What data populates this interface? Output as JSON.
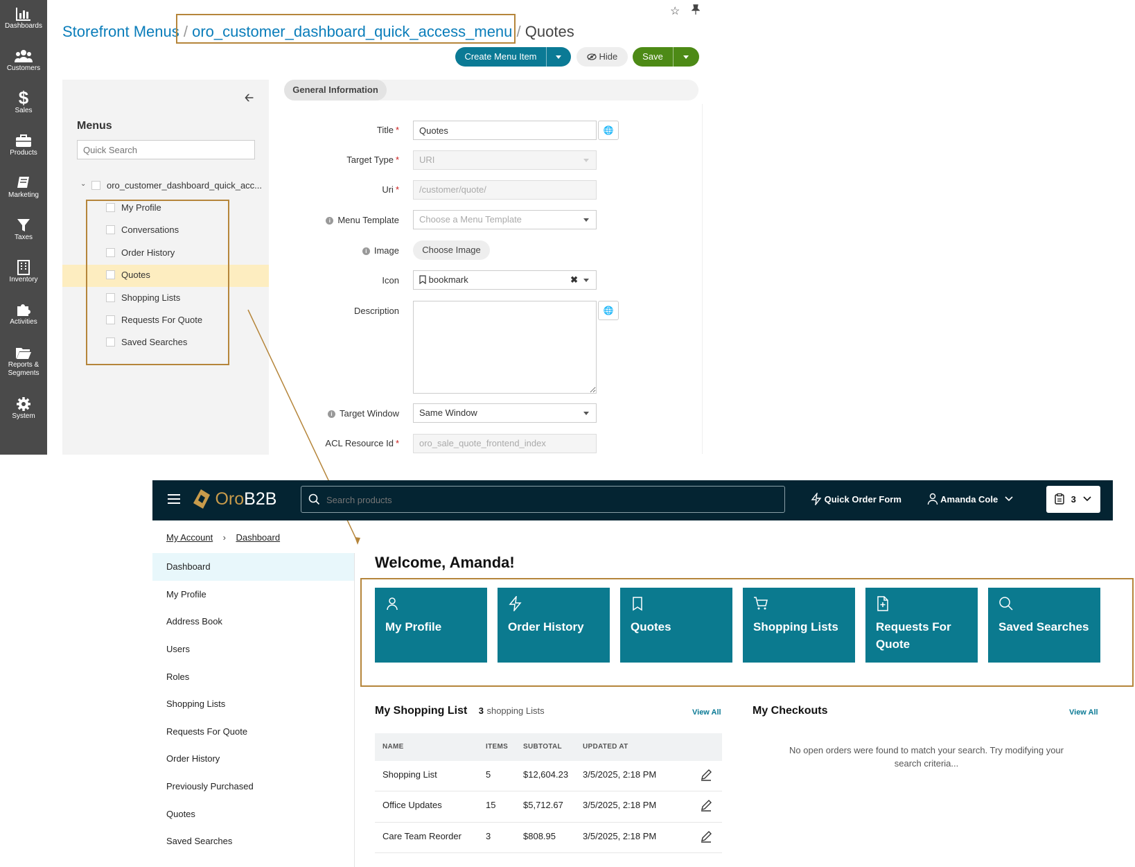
{
  "admin_nav": [
    {
      "label": "Dashboards",
      "icon": "bar-chart-icon"
    },
    {
      "label": "Customers",
      "icon": "users-icon"
    },
    {
      "label": "Sales",
      "icon": "dollar-icon"
    },
    {
      "label": "Products",
      "icon": "briefcase-icon"
    },
    {
      "label": "Marketing",
      "icon": "book-icon"
    },
    {
      "label": "Taxes",
      "icon": "filter-icon"
    },
    {
      "label": "Inventory",
      "icon": "building-icon"
    },
    {
      "label": "Activities",
      "icon": "puzzle-icon"
    },
    {
      "label": "Reports &",
      "label2": "Segments",
      "icon": "folder-icon"
    },
    {
      "label": "System",
      "icon": "gear-icon"
    }
  ],
  "breadcrumb": {
    "root": "Storefront Menus",
    "sep": "/",
    "menu": "oro_customer_dashboard_quick_access_menu",
    "current": "Quotes"
  },
  "toolbar": {
    "create_label": "Create Menu Item",
    "hide_label": "Hide",
    "save_label": "Save"
  },
  "menus_panel": {
    "title": "Menus",
    "search_placeholder": "Quick Search",
    "root_item": "oro_customer_dashboard_quick_acc...",
    "items": [
      "My Profile",
      "Conversations",
      "Order History",
      "Quotes",
      "Shopping Lists",
      "Requests For Quote",
      "Saved Searches"
    ]
  },
  "form": {
    "section_tab": "General Information",
    "title_label": "Title",
    "title_value": "Quotes",
    "target_type_label": "Target Type",
    "target_type_value": "URI",
    "uri_label": "Uri",
    "uri_value": "/customer/quote/",
    "template_label": "Menu Template",
    "template_placeholder": "Choose a Menu Template",
    "image_label": "Image",
    "image_button": "Choose Image",
    "icon_label": "Icon",
    "icon_value": "bookmark",
    "description_label": "Description",
    "target_window_label": "Target Window",
    "target_window_value": "Same Window",
    "acl_label": "ACL Resource Id",
    "acl_value": "oro_sale_quote_frontend_index"
  },
  "storefront": {
    "logo_text_oro": "Oro",
    "logo_text_b2b": "B2B",
    "search_placeholder": "Search products",
    "quick_order": "Quick Order Form",
    "user_name": "Amanda Cole",
    "cart_count": "3",
    "breadcrumb": [
      "My Account",
      "Dashboard"
    ],
    "sidebar": [
      "Dashboard",
      "My Profile",
      "Address Book",
      "Users",
      "Roles",
      "Shopping Lists",
      "Requests For Quote",
      "Order History",
      "Previously Purchased",
      "Quotes",
      "Saved Searches"
    ],
    "welcome": "Welcome, Amanda!",
    "tiles": [
      {
        "label": "My Profile",
        "icon": "user-icon"
      },
      {
        "label": "Order History",
        "icon": "bolt-icon"
      },
      {
        "label": "Quotes",
        "icon": "bookmark-icon"
      },
      {
        "label": "Shopping Lists",
        "icon": "cart-icon"
      },
      {
        "label": "Requests For Quote",
        "icon": "file-plus-icon"
      },
      {
        "label": "Saved Searches",
        "icon": "search-icon"
      }
    ],
    "shopping_list": {
      "title": "My Shopping List",
      "count": "3",
      "count_label": "shopping Lists",
      "view_all": "View All",
      "columns": [
        "NAME",
        "ITEMS",
        "SUBTOTAL",
        "UPDATED AT"
      ],
      "rows": [
        {
          "name": "Shopping List",
          "items": "5",
          "subtotal": "$12,604.23",
          "updated": "3/5/2025, 2:18 PM"
        },
        {
          "name": "Office Updates",
          "items": "15",
          "subtotal": "$5,712.67",
          "updated": "3/5/2025, 2:18 PM"
        },
        {
          "name": "Care Team Reorder",
          "items": "3",
          "subtotal": "$808.95",
          "updated": "3/5/2025, 2:18 PM"
        }
      ]
    },
    "checkouts": {
      "title": "My Checkouts",
      "view_all": "View All",
      "empty_line1": "No open orders were found to match your search. Try modifying your",
      "empty_line2": "search criteria..."
    }
  },
  "colors": {
    "admin_sidebar": "#4a4a4a",
    "link_blue": "#0a7dba",
    "highlight": "#b5853a",
    "tile_teal": "#0b7a8f",
    "header_dark": "#042432"
  }
}
